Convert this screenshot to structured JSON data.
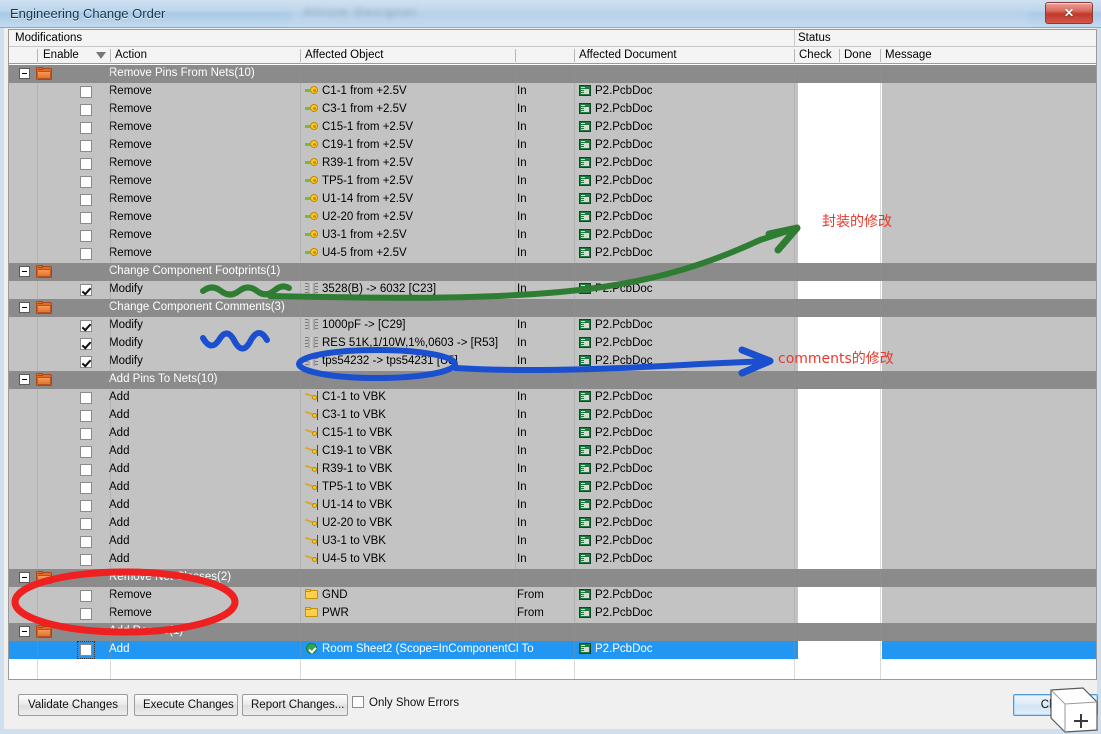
{
  "window": {
    "title": "Engineering Change Order",
    "blurred_background_title": "Altium Designer",
    "close_label": "✕"
  },
  "panel_groups": {
    "modifications": "Modifications",
    "status": "Status"
  },
  "columns": [
    {
      "key": "enable",
      "label": "Enable"
    },
    {
      "key": "action",
      "label": "Action"
    },
    {
      "key": "object",
      "label": "Affected Object"
    },
    {
      "key": "document",
      "label": "Affected Document"
    },
    {
      "key": "check",
      "label": "Check"
    },
    {
      "key": "done",
      "label": "Done"
    },
    {
      "key": "message",
      "label": "Message"
    }
  ],
  "sort_indicator_column": "enable",
  "groups": [
    {
      "title": "Remove Pins From Nets(10)",
      "icon": "folder-icon",
      "expanded": true,
      "rows": [
        {
          "enabled": false,
          "action": "Remove",
          "icon": "pin-icon",
          "object": "C1-1 from +2.5V",
          "mid": "In",
          "document": "P2.PcbDoc",
          "check": "",
          "done": "",
          "message": ""
        },
        {
          "enabled": false,
          "action": "Remove",
          "icon": "pin-icon",
          "object": "C3-1 from +2.5V",
          "mid": "In",
          "document": "P2.PcbDoc",
          "check": "",
          "done": "",
          "message": ""
        },
        {
          "enabled": false,
          "action": "Remove",
          "icon": "pin-icon",
          "object": "C15-1 from +2.5V",
          "mid": "In",
          "document": "P2.PcbDoc",
          "check": "",
          "done": "",
          "message": ""
        },
        {
          "enabled": false,
          "action": "Remove",
          "icon": "pin-icon",
          "object": "C19-1 from +2.5V",
          "mid": "In",
          "document": "P2.PcbDoc",
          "check": "",
          "done": "",
          "message": ""
        },
        {
          "enabled": false,
          "action": "Remove",
          "icon": "pin-icon",
          "object": "R39-1 from +2.5V",
          "mid": "In",
          "document": "P2.PcbDoc",
          "check": "",
          "done": "",
          "message": ""
        },
        {
          "enabled": false,
          "action": "Remove",
          "icon": "pin-icon",
          "object": "TP5-1 from +2.5V",
          "mid": "In",
          "document": "P2.PcbDoc",
          "check": "",
          "done": "",
          "message": ""
        },
        {
          "enabled": false,
          "action": "Remove",
          "icon": "pin-icon",
          "object": "U1-14 from +2.5V",
          "mid": "In",
          "document": "P2.PcbDoc",
          "check": "",
          "done": "",
          "message": ""
        },
        {
          "enabled": false,
          "action": "Remove",
          "icon": "pin-icon",
          "object": "U2-20 from +2.5V",
          "mid": "In",
          "document": "P2.PcbDoc",
          "check": "",
          "done": "",
          "message": ""
        },
        {
          "enabled": false,
          "action": "Remove",
          "icon": "pin-icon",
          "object": "U3-1 from +2.5V",
          "mid": "In",
          "document": "P2.PcbDoc",
          "check": "",
          "done": "",
          "message": ""
        },
        {
          "enabled": false,
          "action": "Remove",
          "icon": "pin-icon",
          "object": "U4-5 from +2.5V",
          "mid": "In",
          "document": "P2.PcbDoc",
          "check": "",
          "done": "",
          "message": ""
        }
      ]
    },
    {
      "title": "Change Component Footprints(1)",
      "icon": "folder-icon",
      "expanded": true,
      "rows": [
        {
          "enabled": true,
          "action": "Modify",
          "icon": "component-icon",
          "object": "3528(B) -> 6032 [C23]",
          "mid": "In",
          "document": "P2.PcbDoc",
          "check": "",
          "done": "",
          "message": ""
        }
      ]
    },
    {
      "title": "Change Component Comments(3)",
      "icon": "folder-icon",
      "expanded": true,
      "rows": [
        {
          "enabled": true,
          "action": "Modify",
          "icon": "component-icon",
          "object": "1000pF ->  [C29]",
          "mid": "In",
          "document": "P2.PcbDoc",
          "check": "",
          "done": "",
          "message": ""
        },
        {
          "enabled": true,
          "action": "Modify",
          "icon": "component-icon",
          "object": "RES  51K,1/10W,1%,0603 ->  [R53]",
          "mid": "In",
          "document": "P2.PcbDoc",
          "check": "",
          "done": "",
          "message": ""
        },
        {
          "enabled": true,
          "action": "Modify",
          "icon": "component-icon",
          "object": "tps54232 -> tps54231 [U5]",
          "mid": "In",
          "document": "P2.PcbDoc",
          "check": "",
          "done": "",
          "message": ""
        }
      ]
    },
    {
      "title": "Add Pins To Nets(10)",
      "icon": "folder-icon",
      "expanded": true,
      "rows": [
        {
          "enabled": false,
          "action": "Add",
          "icon": "add-pin-icon",
          "object": "C1-1 to VBK",
          "mid": "In",
          "document": "P2.PcbDoc",
          "check": "",
          "done": "",
          "message": ""
        },
        {
          "enabled": false,
          "action": "Add",
          "icon": "add-pin-icon",
          "object": "C3-1 to VBK",
          "mid": "In",
          "document": "P2.PcbDoc",
          "check": "",
          "done": "",
          "message": ""
        },
        {
          "enabled": false,
          "action": "Add",
          "icon": "add-pin-icon",
          "object": "C15-1 to VBK",
          "mid": "In",
          "document": "P2.PcbDoc",
          "check": "",
          "done": "",
          "message": ""
        },
        {
          "enabled": false,
          "action": "Add",
          "icon": "add-pin-icon",
          "object": "C19-1 to VBK",
          "mid": "In",
          "document": "P2.PcbDoc",
          "check": "",
          "done": "",
          "message": ""
        },
        {
          "enabled": false,
          "action": "Add",
          "icon": "add-pin-icon",
          "object": "R39-1 to VBK",
          "mid": "In",
          "document": "P2.PcbDoc",
          "check": "",
          "done": "",
          "message": ""
        },
        {
          "enabled": false,
          "action": "Add",
          "icon": "add-pin-icon",
          "object": "TP5-1 to VBK",
          "mid": "In",
          "document": "P2.PcbDoc",
          "check": "",
          "done": "",
          "message": ""
        },
        {
          "enabled": false,
          "action": "Add",
          "icon": "add-pin-icon",
          "object": "U1-14 to VBK",
          "mid": "In",
          "document": "P2.PcbDoc",
          "check": "",
          "done": "",
          "message": ""
        },
        {
          "enabled": false,
          "action": "Add",
          "icon": "add-pin-icon",
          "object": "U2-20 to VBK",
          "mid": "In",
          "document": "P2.PcbDoc",
          "check": "",
          "done": "",
          "message": ""
        },
        {
          "enabled": false,
          "action": "Add",
          "icon": "add-pin-icon",
          "object": "U3-1 to VBK",
          "mid": "In",
          "document": "P2.PcbDoc",
          "check": "",
          "done": "",
          "message": ""
        },
        {
          "enabled": false,
          "action": "Add",
          "icon": "add-pin-icon",
          "object": "U4-5 to VBK",
          "mid": "In",
          "document": "P2.PcbDoc",
          "check": "",
          "done": "",
          "message": ""
        }
      ]
    },
    {
      "title": "Remove Net Classes(2)",
      "icon": "folder-icon",
      "expanded": true,
      "rows": [
        {
          "enabled": false,
          "action": "Remove",
          "icon": "netclass-icon",
          "object": "GND",
          "mid": "From",
          "document": "P2.PcbDoc",
          "check": "",
          "done": "",
          "message": ""
        },
        {
          "enabled": false,
          "action": "Remove",
          "icon": "netclass-icon",
          "object": "PWR",
          "mid": "From",
          "document": "P2.PcbDoc",
          "check": "",
          "done": "",
          "message": ""
        }
      ]
    },
    {
      "title": "Add Rooms(1)",
      "icon": "folder-icon",
      "expanded": true,
      "rows": [
        {
          "enabled": false,
          "selected": true,
          "focused": true,
          "action": "Add",
          "icon": "room-icon",
          "object": "Room Sheet2 (Scope=InComponentCl To",
          "mid": "",
          "document": "P2.PcbDoc",
          "check": "",
          "done": "",
          "message": ""
        }
      ]
    }
  ],
  "footer": {
    "validate_label": "Validate Changes",
    "execute_label": "Execute Changes",
    "report_label": "Report Changes...",
    "only_show_errors_label": "Only Show Errors",
    "only_show_errors_checked": false,
    "close_label": "Close"
  },
  "annotations": [
    {
      "id": "footprint-note",
      "text": "封装的修改",
      "color": "#e8392c",
      "pointer_color": "#2e7d32"
    },
    {
      "id": "comments-note",
      "text": "comments的修改",
      "color": "#e8392c",
      "pointer_color": "#1a4fd0"
    }
  ],
  "colors": {
    "group_row_bg": "#8b8b8b",
    "detail_row_bg": "#c3c3c3",
    "selected_row_bg": "#2196f3",
    "annotation_red": "#e8392c",
    "annotation_green": "#2e7d32",
    "annotation_blue": "#1a4fd0"
  }
}
